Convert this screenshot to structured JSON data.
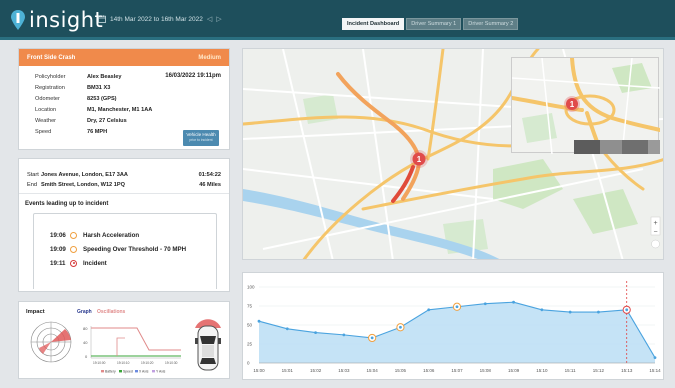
{
  "app": {
    "name": "insight",
    "date_range": "14th Mar 2022 to 16th Mar 2022",
    "date_nav": "◁ ▷"
  },
  "tabs": [
    {
      "label": "Incident Dashboard",
      "active": true
    },
    {
      "label": "Driver Summary 1",
      "active": false
    },
    {
      "label": "Driver Summary 2",
      "active": false
    }
  ],
  "incident": {
    "title": "Front Side Crash",
    "severity": "Medium",
    "datetime": "16/03/2022 19:11pm",
    "fields": [
      {
        "label": "Policyholder",
        "value": "Alex Beasley"
      },
      {
        "label": "Registration",
        "value": "BM31 X3"
      },
      {
        "label": "Odometer",
        "value": "8253 (GPS)"
      },
      {
        "label": "Location",
        "value": "M1, Manchester, M1 1AA"
      },
      {
        "label": "Weather",
        "value": "Dry, 27 Celsius"
      },
      {
        "label": "Speed",
        "value": "76 MPH"
      }
    ],
    "vehicle_health_button": "Vehicle Health",
    "vehicle_health_sub": "prior to incident"
  },
  "journey": {
    "start_label": "Start",
    "start_address": "Jones Avenue, London, E17 3AA",
    "start_value": "01:54:22",
    "end_label": "End",
    "end_address": "Smith Street, London, W12 1PQ",
    "end_value": "46 Miles",
    "events_title": "Events leading up to incident",
    "events": [
      {
        "time": "19:06",
        "label": "Harsh Acceleration",
        "kind": "warning"
      },
      {
        "time": "19:09",
        "label": "Speeding Over Threshold - 70 MPH",
        "kind": "warning"
      },
      {
        "time": "19:11",
        "label": "Incident",
        "kind": "incident"
      }
    ]
  },
  "impact": {
    "title": "Impact",
    "tab_graph": "Graph",
    "tab_oscillations": "Oscillations",
    "mini_chart": {
      "type": "line",
      "y_ticks": [
        "80",
        "40",
        "0"
      ],
      "x_ticks": [
        "19:10:00",
        "19:10:10",
        "19:10:20",
        "19:10:30"
      ],
      "legend": [
        "Battery",
        "Speed",
        "X Axis",
        "Y Axis"
      ],
      "colors": {
        "Battery": "#e08a8a",
        "Speed": "#3aa53a"
      }
    }
  },
  "map": {
    "marker_label": "1",
    "inset_marker_label": "1"
  },
  "chart_data": {
    "type": "area",
    "x": [
      "15:00",
      "15:01",
      "15:02",
      "15:03",
      "15:04",
      "15:05",
      "15:06",
      "15:07",
      "15:08",
      "15:09",
      "15:10",
      "15:11",
      "15:12",
      "15:13",
      "15:14"
    ],
    "y_ticks": [
      0,
      25,
      50,
      75,
      100
    ],
    "ylim": [
      0,
      100
    ],
    "series": [
      {
        "values": [
          55,
          45,
          40,
          37,
          33,
          47,
          70,
          74,
          78,
          80,
          70,
          67,
          67,
          70,
          7
        ],
        "color": "#4aa3df",
        "fill": "#bfe0f5"
      }
    ],
    "highlighted_x": [
      "15:04",
      "15:05",
      "15:07",
      "15:13"
    ],
    "marker_line_x": "15:13",
    "marker_line_color": "#e04040"
  }
}
